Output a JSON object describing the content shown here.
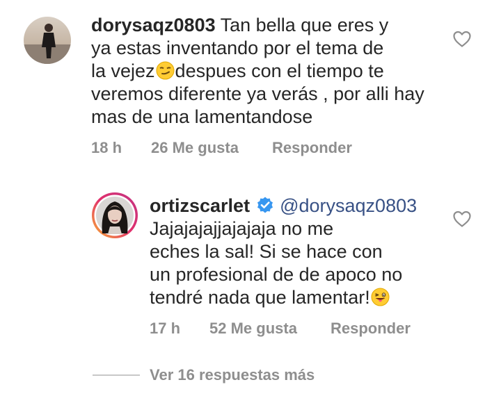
{
  "comments": [
    {
      "username": "dorysaqz0803",
      "lines": [
        "Tan bella que eres y",
        "ya estas inventando por el tema de",
        "la vejez",
        "despues con el tiempo te",
        "veremos diferente ya verás , por alli hay",
        "mas de una lamentandose"
      ],
      "time": "18 h",
      "likes": "26 Me gusta",
      "reply_label": "Responder",
      "emoji_icon": "smirking-face-icon"
    },
    {
      "username": "ortizscarlet",
      "verified_icon": "verified-badge-icon",
      "mention": "@dorysaqz0803",
      "lines": [
        "Jajajajajjajajaja no me",
        "eches la sal! Si se hace con",
        "un profesional de de apoco no",
        "tendré nada que lamentar!"
      ],
      "time": "17 h",
      "likes": "52 Me gusta",
      "reply_label": "Responder",
      "emoji_icon": "winking-face-with-tongue-icon"
    }
  ],
  "more_replies_label": "Ver 16 respuestas más",
  "colors": {
    "text": "#262626",
    "muted": "#8e8e8e",
    "mention": "#385185",
    "verified": "#3897f0"
  }
}
